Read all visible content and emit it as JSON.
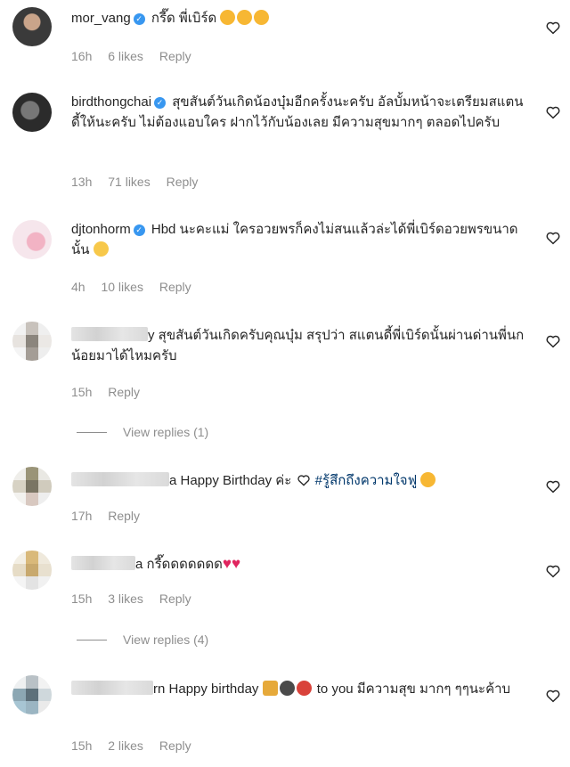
{
  "comments": [
    {
      "username": "mor_vang",
      "text": "กรี๊ด พี่เบิร์ด",
      "time": "16h",
      "likes": "6 likes",
      "reply": "Reply"
    },
    {
      "username": "birdthongchai",
      "text": "สุขสันต์วันเกิดน้องบุ๋มอีกครั้งนะครับ อัลบั้มหน้าจะเตรียมสแตนดี้ให้นะครับ ไม่ต้องแอบใคร ฝากไว้กับน้องเลย มีความสุขมากๆ ตลอดไปครับ",
      "time": "13h",
      "likes": "71 likes",
      "reply": "Reply"
    },
    {
      "username": "djtonhorm",
      "text": "Hbd นะคะแม่ ใครอวยพรก็คงไม่สนแล้วล่ะได้พี่เบิร์ดอวยพรขนาดนั้น",
      "time": "4h",
      "likes": "10 likes",
      "reply": "Reply"
    },
    {
      "username_partial": "y",
      "text": "สุขสันต์วันเกิดครับคุณบุ๋ม สรุปว่า สแตนดี้พี่เบิร์ดนั้นผ่านด่านพี่นกน้อยมาได้ไหมครับ",
      "time": "15h",
      "reply": "Reply",
      "view_replies": "View replies (1)"
    },
    {
      "username_partial": "a",
      "text": "Happy Birthday ค่ะ",
      "hashtag": "#รู้สึกถึงความใจฟู",
      "time": "17h",
      "reply": "Reply"
    },
    {
      "username_partial": "a",
      "text": "กรี๊ดดดดดดด",
      "time": "15h",
      "likes": "3 likes",
      "reply": "Reply",
      "view_replies": "View replies (4)"
    },
    {
      "username_partial": "rn",
      "text": "Happy birthday",
      "text2": "to you มีความสุข มากๆ ๆๆนะค้าบ",
      "time": "15h",
      "likes": "2 likes",
      "reply": "Reply"
    }
  ],
  "colors": {
    "verified": "#3897f0",
    "meta": "#8e8e8e",
    "hashtag": "#00376b",
    "heart_red": "#e0245e"
  },
  "icons": {
    "like": "heart-outline-icon",
    "verified": "verified-badge-icon"
  }
}
